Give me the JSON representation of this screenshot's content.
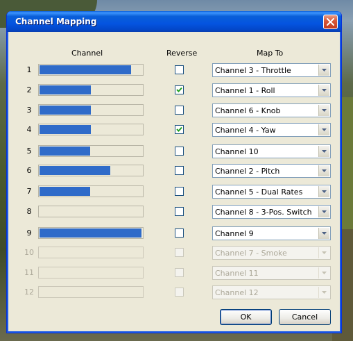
{
  "window": {
    "title": "Channel Mapping"
  },
  "headers": {
    "channel": "Channel",
    "reverse": "Reverse",
    "map_to": "Map To"
  },
  "rows": [
    {
      "num": "1",
      "level": 0.89,
      "reverse": false,
      "map": "Channel 3 - Throttle",
      "enabled": true
    },
    {
      "num": "2",
      "level": 0.5,
      "reverse": true,
      "map": "Channel 1 - Roll",
      "enabled": true
    },
    {
      "num": "3",
      "level": 0.5,
      "reverse": false,
      "map": "Channel 6 - Knob",
      "enabled": true
    },
    {
      "num": "4",
      "level": 0.5,
      "reverse": true,
      "map": "Channel 4 - Yaw",
      "enabled": true
    },
    {
      "num": "5",
      "level": 0.49,
      "reverse": false,
      "map": "Channel 10",
      "enabled": true
    },
    {
      "num": "6",
      "level": 0.69,
      "reverse": false,
      "map": "Channel 2 - Pitch",
      "enabled": true
    },
    {
      "num": "7",
      "level": 0.49,
      "reverse": false,
      "map": "Channel 5 - Dual Rates",
      "enabled": true
    },
    {
      "num": "8",
      "level": 0.0,
      "reverse": false,
      "map": "Channel 8 - 3-Pos. Switch",
      "enabled": true
    },
    {
      "num": "9",
      "level": 0.99,
      "reverse": false,
      "map": "Channel 9",
      "enabled": true
    },
    {
      "num": "10",
      "level": 0.0,
      "reverse": false,
      "map": "Channel 7 - Smoke",
      "enabled": false
    },
    {
      "num": "11",
      "level": 0.0,
      "reverse": false,
      "map": "Channel 11",
      "enabled": false
    },
    {
      "num": "12",
      "level": 0.0,
      "reverse": false,
      "map": "Channel 12",
      "enabled": false
    }
  ],
  "buttons": {
    "ok": "OK",
    "cancel": "Cancel"
  },
  "colors": {
    "bar_fill": "#2f6bc9",
    "dialog_bg": "#ece9d8",
    "titlebar": "#0454e0"
  }
}
